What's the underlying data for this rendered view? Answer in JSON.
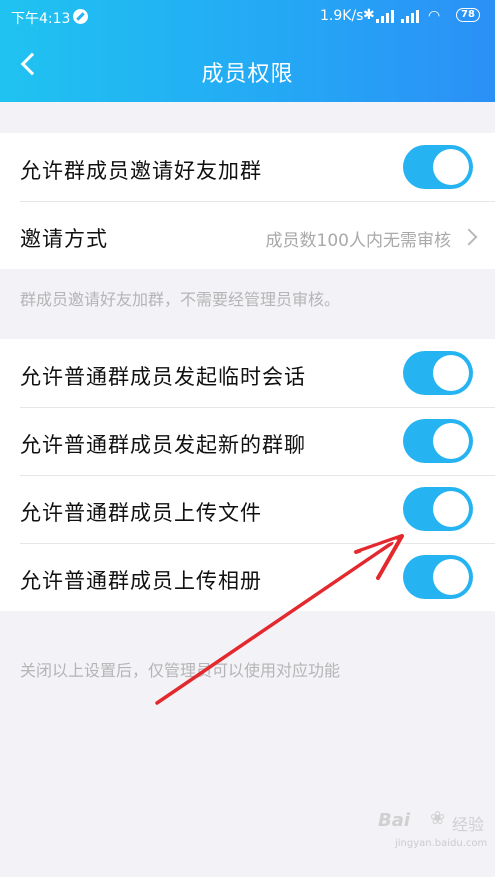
{
  "status_bar": {
    "time": "下午4:13",
    "speed": "1.9K/s",
    "bluetooth_icon": "✱",
    "wifi_icon": "◠",
    "battery": "78"
  },
  "header": {
    "title": "成员权限",
    "back_icon": "chevron-left-icon"
  },
  "section1": {
    "invite_toggle_label": "允许群成员邀请好友加群",
    "invite_toggle_on": true,
    "invite_method_label": "邀请方式",
    "invite_method_value": "成员数100人内无需审核",
    "note": "群成员邀请好友加群，不需要经管理员审核。"
  },
  "section2": {
    "items": [
      {
        "label": "允许普通群成员发起临时会话",
        "on": true
      },
      {
        "label": "允许普通群成员发起新的群聊",
        "on": true
      },
      {
        "label": "允许普通群成员上传文件",
        "on": true
      },
      {
        "label": "允许普通群成员上传相册",
        "on": true
      }
    ],
    "note": "关闭以上设置后，仅管理员可以使用对应功能"
  },
  "colors": {
    "accent": "#26b3f2",
    "arrow": "#e3292e",
    "background": "#f2f2f7"
  },
  "watermark": {
    "text": "Bai",
    "text2": "经验",
    "url": "jingyan.baidu.com"
  }
}
